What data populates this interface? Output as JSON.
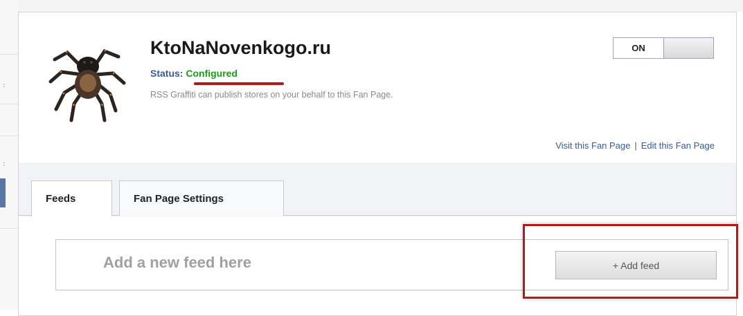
{
  "app": {
    "page_name": "KtoNaNovenkogo.ru",
    "status_label": "Status:",
    "status_value": "Configured",
    "description": "RSS Graffiti can publish stores on your behalf to this Fan Page.",
    "toggle_label": "ON",
    "links": {
      "visit": "Visit this Fan Page",
      "separator": "|",
      "edit": "Edit this Fan Page"
    },
    "tabs": [
      {
        "label": "Feeds",
        "active": true
      },
      {
        "label": "Fan Page Settings",
        "active": false
      }
    ],
    "feed": {
      "prompt": "Add a new feed here",
      "add_button": "+ Add feed"
    }
  },
  "colors": {
    "link": "#3b5998",
    "status_ok": "#1a9b1a",
    "annotation": "#b11a1a"
  },
  "icons": {
    "avatar": "tarantula-avatar-icon",
    "left_marks": [
      ":",
      ":"
    ]
  }
}
